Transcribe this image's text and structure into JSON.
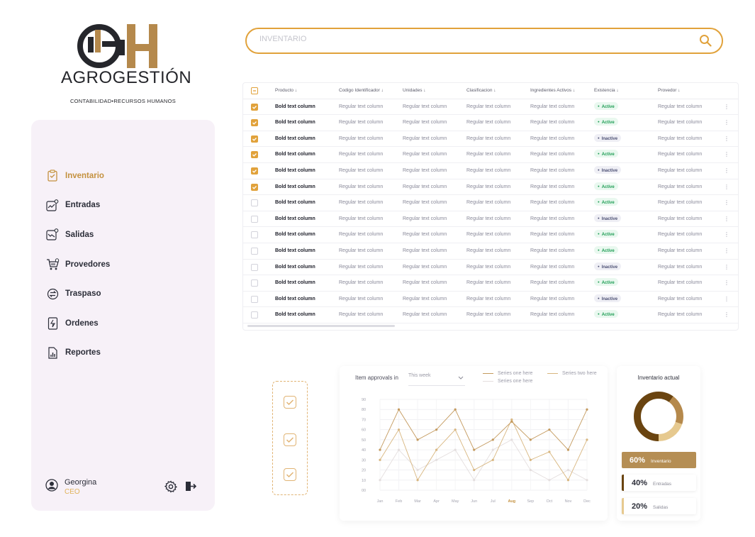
{
  "brand": {
    "name": "AGROGESTIÓN",
    "tagline": "CONTABILIDAD•RECURSOS HUMANOS",
    "logo_letters": "GH"
  },
  "colors": {
    "accent": "#e1a23b",
    "brand_gold": "#b5894c",
    "sidebar_bg": "#f7f1f8",
    "active_badge": "#1f9d55",
    "inactive_badge": "#4b4f73",
    "series_one": "#c49a5e",
    "series_two": "#d8b67f",
    "series_three": "#e4dede"
  },
  "sidebar": {
    "items": [
      {
        "label": "Inventario",
        "icon": "clipboard-icon",
        "active": true
      },
      {
        "label": "Entradas",
        "icon": "trend-up-icon",
        "active": false
      },
      {
        "label": "Salidas",
        "icon": "trend-down-icon",
        "active": false
      },
      {
        "label": "Provedores",
        "icon": "cart-icon",
        "active": false
      },
      {
        "label": "Traspaso",
        "icon": "transfer-icon",
        "active": false
      },
      {
        "label": "Ordenes",
        "icon": "receipt-icon",
        "active": false
      },
      {
        "label": "Reportes",
        "icon": "report-icon",
        "active": false
      }
    ],
    "user": {
      "name": "Georgina",
      "role": "CEO"
    }
  },
  "search": {
    "placeholder": "INVENTARIO"
  },
  "table": {
    "columns": [
      "Producto",
      "Codigo Identificador",
      "Unidades",
      "Clasificacion",
      "Ingredientes Activos",
      "Existencia",
      "Provedor"
    ],
    "rows": [
      {
        "checked": true,
        "producto": "Bold text column",
        "codigo": "Regular text column",
        "unidades": "Regular text column",
        "clasificacion": "Regular text column",
        "ingredientes": "Regular text column",
        "existencia": "Active",
        "provedor": "Regular text column"
      },
      {
        "checked": true,
        "producto": "Bold text column",
        "codigo": "Regular text column",
        "unidades": "Regular text column",
        "clasificacion": "Regular text column",
        "ingredientes": "Regular text column",
        "existencia": "Active",
        "provedor": "Regular text column"
      },
      {
        "checked": true,
        "producto": "Bold text column",
        "codigo": "Regular text column",
        "unidades": "Regular text column",
        "clasificacion": "Regular text column",
        "ingredientes": "Regular text column",
        "existencia": "Inactive",
        "provedor": "Regular text column"
      },
      {
        "checked": true,
        "producto": "Bold text column",
        "codigo": "Regular text column",
        "unidades": "Regular text column",
        "clasificacion": "Regular text column",
        "ingredientes": "Regular text column",
        "existencia": "Active",
        "provedor": "Regular text column"
      },
      {
        "checked": true,
        "producto": "Bold text column",
        "codigo": "Regular text column",
        "unidades": "Regular text column",
        "clasificacion": "Regular text column",
        "ingredientes": "Regular text column",
        "existencia": "Inactive",
        "provedor": "Regular text column"
      },
      {
        "checked": true,
        "producto": "Bold text column",
        "codigo": "Regular text column",
        "unidades": "Regular text column",
        "clasificacion": "Regular text column",
        "ingredientes": "Regular text column",
        "existencia": "Active",
        "provedor": "Regular text column"
      },
      {
        "checked": false,
        "producto": "Bold text column",
        "codigo": "Regular text column",
        "unidades": "Regular text column",
        "clasificacion": "Regular text column",
        "ingredientes": "Regular text column",
        "existencia": "Active",
        "provedor": "Regular text column"
      },
      {
        "checked": false,
        "producto": "Bold text column",
        "codigo": "Regular text column",
        "unidades": "Regular text column",
        "clasificacion": "Regular text column",
        "ingredientes": "Regular text column",
        "existencia": "Inactive",
        "provedor": "Regular text column"
      },
      {
        "checked": false,
        "producto": "Bold text column",
        "codigo": "Regular text column",
        "unidades": "Regular text column",
        "clasificacion": "Regular text column",
        "ingredientes": "Regular text column",
        "existencia": "Active",
        "provedor": "Regular text column"
      },
      {
        "checked": false,
        "producto": "Bold text column",
        "codigo": "Regular text column",
        "unidades": "Regular text column",
        "clasificacion": "Regular text column",
        "ingredientes": "Regular text column",
        "existencia": "Active",
        "provedor": "Regular text column"
      },
      {
        "checked": false,
        "producto": "Bold text column",
        "codigo": "Regular text column",
        "unidades": "Regular text column",
        "clasificacion": "Regular text column",
        "ingredientes": "Regular text column",
        "existencia": "Inactive",
        "provedor": "Regular text column"
      },
      {
        "checked": false,
        "producto": "Bold text column",
        "codigo": "Regular text column",
        "unidades": "Regular text column",
        "clasificacion": "Regular text column",
        "ingredientes": "Regular text column",
        "existencia": "Active",
        "provedor": "Regular text column"
      },
      {
        "checked": false,
        "producto": "Bold text column",
        "codigo": "Regular text column",
        "unidades": "Regular text column",
        "clasificacion": "Regular text column",
        "ingredientes": "Regular text column",
        "existencia": "Inactive",
        "provedor": "Regular text column"
      },
      {
        "checked": false,
        "producto": "Bold text column",
        "codigo": "Regular text column",
        "unidades": "Regular text column",
        "clasificacion": "Regular text column",
        "ingredientes": "Regular text column",
        "existencia": "Active",
        "provedor": "Regular text column"
      }
    ]
  },
  "checklist": {
    "items": 3
  },
  "chart_data": {
    "type": "line",
    "title": "Item approvals in",
    "period_select": "This week",
    "categories": [
      "Jan",
      "Feb",
      "Mar",
      "Apr",
      "May",
      "Jun",
      "Jul",
      "Aug",
      "Sep",
      "Oct",
      "Nov",
      "Dec"
    ],
    "highlighted_category": "Aug",
    "yticks": [
      "00",
      "10",
      "20",
      "30",
      "40",
      "50",
      "60",
      "70",
      "80",
      "90"
    ],
    "ylim": [
      0,
      90
    ],
    "grid": true,
    "legend_position": "top-right",
    "series": [
      {
        "name": "Series one here",
        "values": [
          40,
          80,
          50,
          60,
          80,
          40,
          50,
          68,
          50,
          60,
          40,
          80
        ]
      },
      {
        "name": "Series two here",
        "values": [
          30,
          60,
          10,
          40,
          60,
          20,
          30,
          70,
          30,
          38,
          10,
          50
        ]
      },
      {
        "name": "Series one here",
        "values": [
          10,
          40,
          20,
          30,
          40,
          10,
          40,
          50,
          20,
          10,
          20,
          10
        ]
      }
    ]
  },
  "inventory": {
    "title": "Inventario actual",
    "donut": [
      {
        "label": "Inventario",
        "value": 60,
        "color": "#6a4410"
      },
      {
        "label": "Entradas",
        "value": 20,
        "color": "#b5894c"
      },
      {
        "label": "Salidas",
        "value": 20,
        "color": "#e6c98f"
      }
    ],
    "stats": [
      {
        "pct": "60%",
        "label": "Inventario"
      },
      {
        "pct": "40%",
        "label": "Entradas"
      },
      {
        "pct": "20%",
        "label": "Salidas"
      }
    ]
  }
}
